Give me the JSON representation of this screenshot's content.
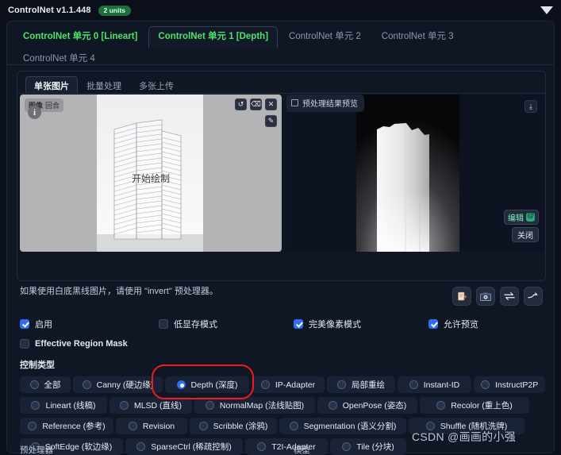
{
  "header": {
    "title": "ControlNet v1.1.448",
    "units_badge": "2 units",
    "collapse_icon": "caret-down-icon"
  },
  "unit_tabs": [
    {
      "label": "ControlNet 单元 0 [Lineart]",
      "active": false,
      "accent": "green"
    },
    {
      "label": "ControlNet 单元 1 [Depth]",
      "active": true,
      "accent": "green"
    },
    {
      "label": "ControlNet 单元 2",
      "active": false,
      "accent": "muted"
    },
    {
      "label": "ControlNet 单元 3",
      "active": false,
      "accent": "muted"
    },
    {
      "label": "ControlNet 单元 4",
      "active": false,
      "accent": "muted"
    }
  ],
  "sub_tabs": [
    {
      "label": "单张图片",
      "active": true
    },
    {
      "label": "批量处理",
      "active": false
    },
    {
      "label": "多张上传",
      "active": false
    }
  ],
  "image_panel": {
    "left": {
      "badge_label": "图像",
      "badge_mini": "回合",
      "info_glyph": "i",
      "canvas_overlay_text": "开始绘制",
      "tools": [
        {
          "name": "undo-icon",
          "glyph": "↺"
        },
        {
          "name": "eraser-icon",
          "glyph": "⌫"
        },
        {
          "name": "close-icon",
          "glyph": "✕"
        }
      ],
      "tool_secondary": {
        "name": "brush-icon",
        "glyph": "✎"
      }
    },
    "right": {
      "preview_chip_label": "预处理结果预览",
      "preview_chip_icon": "image-frame-icon",
      "download_icon": "download-icon",
      "edit_label": "编辑",
      "edit_icon": "photopea-icon",
      "close_label": "关闭"
    }
  },
  "hint_text": "如果使用白底黑线图片，请使用 \"invert\" 预处理器。",
  "action_icons": [
    {
      "name": "upload-independent-control-image-icon",
      "glyph": "📄"
    },
    {
      "name": "camera-icon",
      "glyph": "📷"
    },
    {
      "name": "swap-width-height-icon",
      "glyph": "⇄"
    },
    {
      "name": "send-dimensions-icon",
      "glyph": "⤴"
    }
  ],
  "checkboxes_row1": [
    {
      "label": "启用",
      "checked": true,
      "name": "enable-checkbox"
    },
    {
      "label": "低显存模式",
      "checked": false,
      "name": "low-vram-checkbox"
    },
    {
      "label": "完美像素模式",
      "checked": true,
      "name": "pixel-perfect-checkbox"
    },
    {
      "label": "允许预览",
      "checked": true,
      "name": "allow-preview-checkbox"
    }
  ],
  "checkboxes_row2": [
    {
      "label": "Effective Region Mask",
      "checked": false,
      "name": "effective-region-mask-checkbox"
    }
  ],
  "control_type": {
    "section_label": "控制类型",
    "selected": "Depth (深度)",
    "highlight_color": "#ee1c1c",
    "rows": [
      [
        {
          "label": "全部",
          "selected": false
        },
        {
          "label": "Canny (硬边缘)",
          "selected": false
        },
        {
          "label": "Depth (深度)",
          "selected": true
        },
        {
          "label": "IP-Adapter",
          "selected": false
        },
        {
          "label": "局部重绘",
          "selected": false
        },
        {
          "label": "Instant-ID",
          "selected": false
        },
        {
          "label": "InstructP2P",
          "selected": false
        }
      ],
      [
        {
          "label": "Lineart (线稿)",
          "selected": false
        },
        {
          "label": "MLSD (直线)",
          "selected": false
        },
        {
          "label": "NormalMap (法线贴图)",
          "selected": false
        },
        {
          "label": "OpenPose (姿态)",
          "selected": false
        },
        {
          "label": "Recolor (重上色)",
          "selected": false
        }
      ],
      [
        {
          "label": "Reference (参考)",
          "selected": false
        },
        {
          "label": "Revision",
          "selected": false
        },
        {
          "label": "Scribble (涂鸦)",
          "selected": false
        },
        {
          "label": "Segmentation (语义分割)",
          "selected": false
        },
        {
          "label": "Shuffle (随机洗牌)",
          "selected": false
        }
      ],
      [
        {
          "label": "SoftEdge (软边缘)",
          "selected": false
        },
        {
          "label": "SparseCtrl (稀疏控制)",
          "selected": false
        },
        {
          "label": "T2I-Adapter",
          "selected": false
        },
        {
          "label": "Tile (分块)",
          "selected": false
        }
      ]
    ]
  },
  "footer": {
    "preprocessor_label": "预处理器",
    "model_label": "模型"
  },
  "watermark": "CSDN @画画的小强"
}
